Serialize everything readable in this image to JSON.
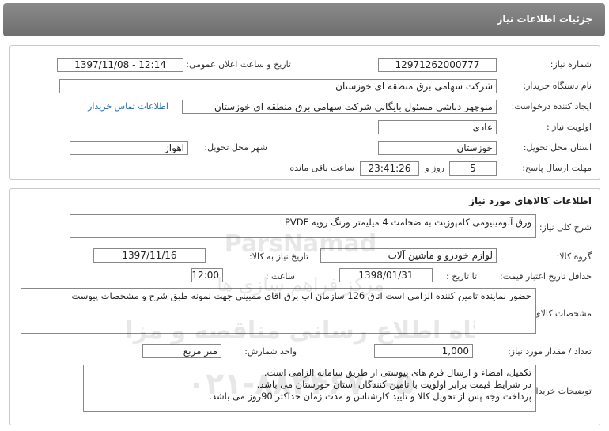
{
  "header": {
    "title": "جزئیات اطلاعات نیاز"
  },
  "need_info": {
    "need_number_label": "شماره نیاز:",
    "need_number": "12971262000777",
    "announce_label": "تاریخ و ساعت اعلان عمومی:",
    "announce_value": "1397/11/08 - 12:14",
    "buyer_org_label": "نام دستگاه خریدار:",
    "buyer_org": "شرکت سهامی برق منطقه ای خوزستان",
    "requester_label": "ایجاد کننده درخواست:",
    "requester": "منوچهر دباشی مسئول بایگانی شرکت سهامی برق منطقه ای خوزستان",
    "contact_link": "اطلاعات تماس خریدار",
    "priority_label": "اولویت نیاز :",
    "priority": "عادی",
    "province_label": "استان محل تحویل:",
    "province": "خوزستان",
    "city_label": "شهر محل تحویل:",
    "city": "اهواز",
    "deadline_label": "مهلت ارسال پاسخ:",
    "days": "5",
    "days_unit": "روز و",
    "time_left": "23:41:26",
    "time_left_label": "ساعت باقی مانده"
  },
  "goods": {
    "section_title": "اطلاعات کالاهای مورد نیاز",
    "summary_label": "شرح کلی نیاز:",
    "summary": "ورق آلومینیومی کامپوزیت به ضخامت 4 میلیمتر ورنگ رویه PVDF",
    "group_label": "گروه کالا:",
    "group": "لوازم خودرو و ماشین آلات",
    "need_date_label": "تاریخ نیاز به کالا:",
    "need_date": "1397/11/16",
    "validity_label": "حداقل تاریخ اعتبار قیمت:",
    "until_label": "تا تاریخ :",
    "validity_date": "1398/01/31",
    "hour_label": "ساعت :",
    "validity_time": "12:00",
    "specs_label": "مشخصات کالای مورد نیاز:",
    "specs": "حضور نماینده تامین کننده الزامی است اتاق 126 سازمان اب برق اقای ممبینی جهت نمونه طبق شرح و مشخصات پیوست",
    "qty_label": "تعداد / مقدار مورد نیاز:",
    "qty": "1,000",
    "unit_label": "واحد شمارش:",
    "unit": "متر مربع",
    "notes_label": "توضیحات خریدار:",
    "notes": [
      "تکمیل، امضاء و ارسال فرم های پیوستی از طریق سامانه الزامی است.",
      "در شرایط  قیمت برابر اولویت با تامین کنندگان استان خوزستان می باشد.",
      "پرداخت وجه پس از تحویل کالا و تایید کارشناس و مدت زمان حداکثر 90روز می باشد."
    ]
  },
  "watermark": {
    "brand": "ParsNamad",
    "line1": "مرکز فراهم سازی ها",
    "line2": "پایگاه اطلاع رسانی مناقصه و مزایده",
    "phone": "۰۲۱-۸۸۳۴۶۷۰-۵"
  }
}
